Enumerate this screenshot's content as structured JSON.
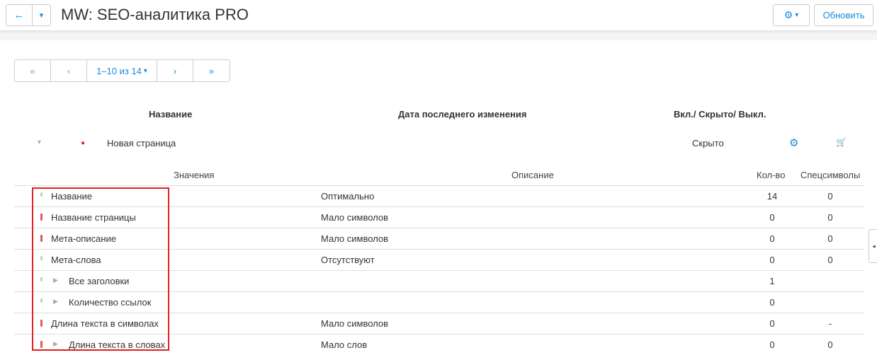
{
  "header": {
    "title": "MW: SEO-аналитика PRO",
    "back_icon": "←",
    "caret_icon": "▾",
    "gear_icon": "⚙",
    "gear_caret": "▾",
    "refresh_label": "Обновить"
  },
  "pager": {
    "first": "«",
    "prev": "‹",
    "range": "1–10 из 14",
    "range_caret": "▾",
    "next": "›",
    "last": "»"
  },
  "columns": {
    "name": "Название",
    "date": "Дата последнего изменения",
    "status": "Вкл./ Скрыто/ Выкл."
  },
  "page_row": {
    "toggle": "▾",
    "dot_color": "#d9262b",
    "dot": "●",
    "name": "Новая страница",
    "status": "Скрыто",
    "gear_icon": "⚙",
    "cart_icon": "🛒"
  },
  "sub_columns": {
    "values": "Значения",
    "description": "Описание",
    "qty": "Кол-во",
    "special": "Спецсимволы"
  },
  "rows": [
    {
      "indicator": "gray",
      "arrow": "",
      "name": "Название",
      "desc": "Оптимально",
      "qty": "14",
      "spec": "0"
    },
    {
      "indicator": "red",
      "arrow": "",
      "name": "Название страницы",
      "desc": "Мало символов",
      "qty": "0",
      "spec": "0"
    },
    {
      "indicator": "red",
      "arrow": "",
      "name": "Мета-описание",
      "desc": "Мало символов",
      "qty": "0",
      "spec": "0"
    },
    {
      "indicator": "gray",
      "arrow": "",
      "name": "Мета-слова",
      "desc": "Отсутствуют",
      "qty": "0",
      "spec": "0"
    },
    {
      "indicator": "gray",
      "arrow": "▶",
      "name": "Все заголовки",
      "desc": "",
      "qty": "1",
      "spec": ""
    },
    {
      "indicator": "gray",
      "arrow": "▶",
      "name": "Количество ссылок",
      "desc": "",
      "qty": "0",
      "spec": ""
    },
    {
      "indicator": "red",
      "arrow": "",
      "name": "Длина текста в символах",
      "desc": "Мало символов",
      "qty": "0",
      "spec": "-"
    },
    {
      "indicator": "red",
      "arrow": "▶",
      "name": "Длина текста в словах",
      "desc": "Мало слов",
      "qty": "0",
      "spec": "0"
    }
  ],
  "side_tab_icon": "◂",
  "colors": {
    "accent": "#1a8ad8",
    "highlight": "#e02020",
    "bad": "#e05a5a",
    "neutral": "#cccccc"
  }
}
